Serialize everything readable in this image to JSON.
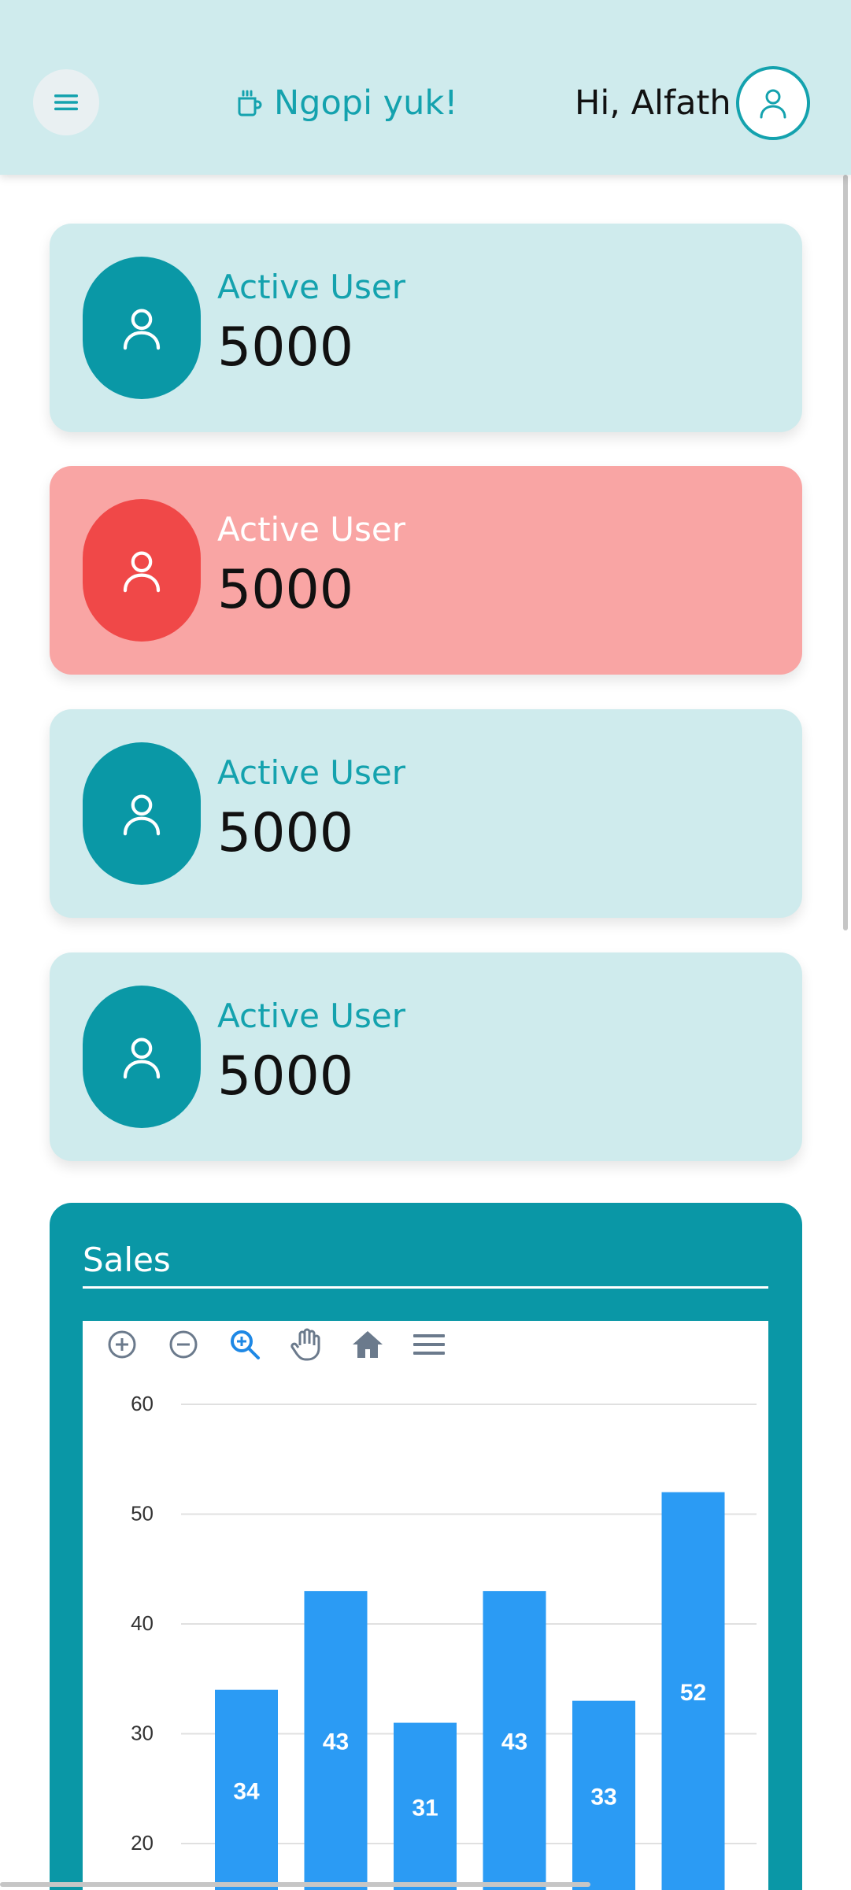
{
  "header": {
    "brand_label": "Ngopi yuk!",
    "greeting": "Hi, Alfath",
    "icons": {
      "menu": "hamburger-icon",
      "brand": "coffee-cup-icon",
      "profile": "user-icon"
    },
    "colors": {
      "background": "#cfebed",
      "accent": "#14a2ae"
    }
  },
  "stats": [
    {
      "label": "Active User",
      "value": "5000",
      "variant": "teal"
    },
    {
      "label": "Active User",
      "value": "5000",
      "variant": "red"
    },
    {
      "label": "Active User",
      "value": "5000",
      "variant": "teal"
    },
    {
      "label": "Active User",
      "value": "5000",
      "variant": "teal"
    }
  ],
  "sales": {
    "title": "Sales",
    "toolbar": [
      "zoom-in-icon",
      "zoom-out-icon",
      "zoom-selection-icon",
      "pan-hand-icon",
      "reset-home-icon",
      "menu-lines-icon"
    ]
  },
  "chart_data": {
    "type": "bar",
    "title": "",
    "xlabel": "",
    "ylabel": "",
    "ylim": [
      0,
      60
    ],
    "yticks": [
      20,
      30,
      40,
      50,
      60
    ],
    "categories": [
      "",
      "",
      "",
      "",
      "",
      ""
    ],
    "values": [
      34,
      43,
      31,
      43,
      33,
      52
    ],
    "data_labels": [
      "34",
      "43",
      "31",
      "43",
      "33",
      "52"
    ],
    "grid": true,
    "bar_color": "#2b9bf4"
  }
}
